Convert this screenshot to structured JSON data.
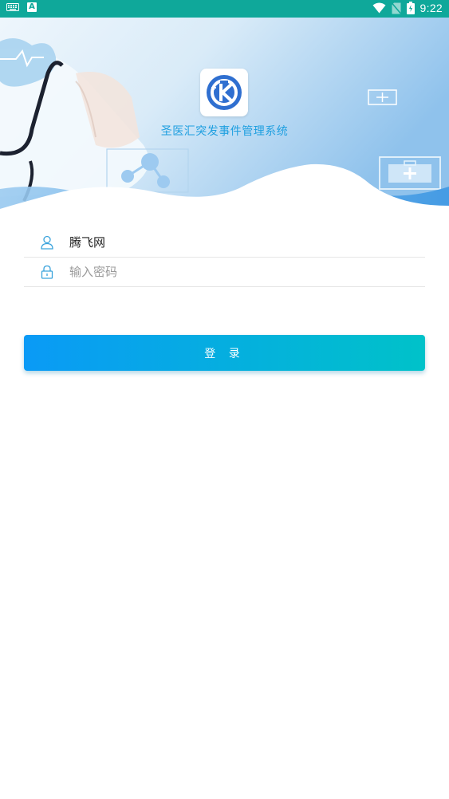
{
  "status_bar": {
    "time": "9:22",
    "a_badge": "A",
    "icons": [
      "keyboard-icon",
      "a-notification-icon",
      "wifi-icon",
      "no-sim-icon",
      "battery-icon"
    ],
    "background_color": "#0fa89a"
  },
  "header": {
    "app_title": "圣医汇突发事件管理系统",
    "logo_icon": "app-logo-icon",
    "title_color": "#1e9fe0"
  },
  "login_form": {
    "username": {
      "value": "腾飞网",
      "icon": "user-icon"
    },
    "password": {
      "value": "",
      "placeholder": "输入密码",
      "icon": "lock-icon"
    },
    "submit_label": "登 录",
    "button_gradient": [
      "#0a9af6",
      "#00c2c9"
    ]
  }
}
